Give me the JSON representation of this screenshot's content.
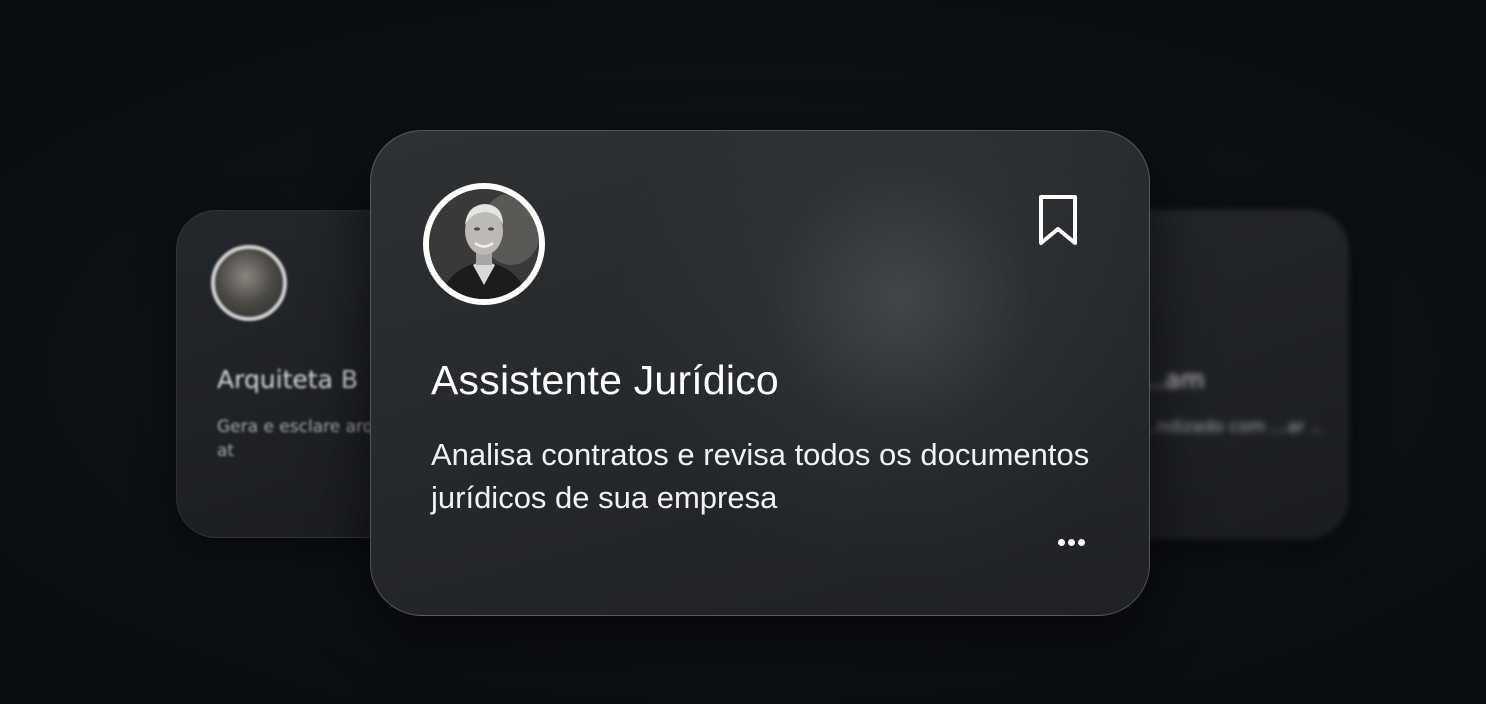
{
  "cards": {
    "left": {
      "title": "Arquiteta B",
      "description": "Gera e esclare arquiteturas at"
    },
    "right": {
      "title": "...am",
      "description": "...ndizado com ...ar .."
    },
    "main": {
      "title": "Assistente Jurídico",
      "description": "Analisa contratos e revisa todos os documentos jurídicos de sua empresa",
      "bookmark_icon": "bookmark-icon",
      "more_icon": "more-options-icon"
    }
  },
  "colors": {
    "background": "#0f1216",
    "card": "#2a2d30",
    "text": "#ffffff"
  }
}
